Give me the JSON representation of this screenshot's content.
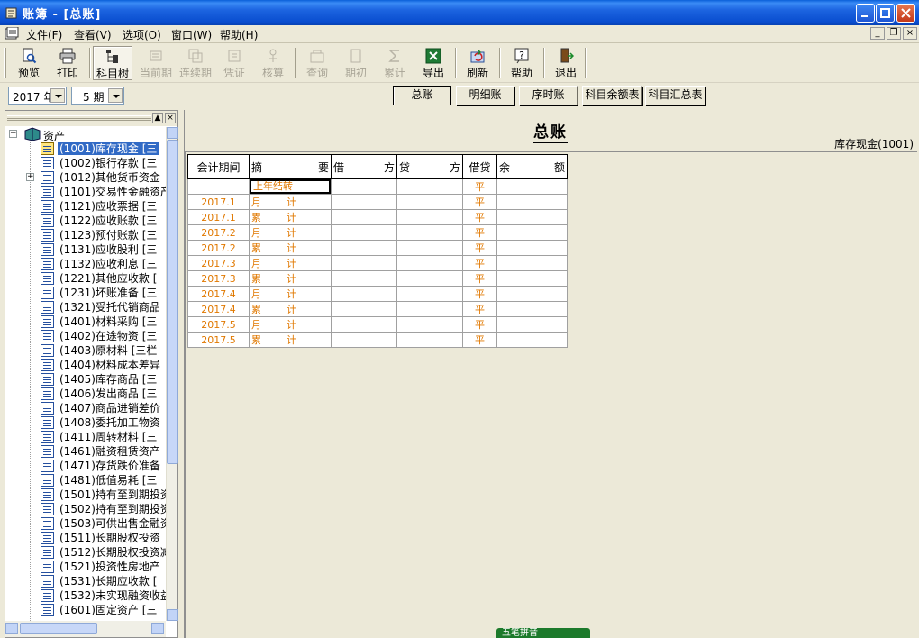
{
  "window": {
    "title": "账簿 - [总账]"
  },
  "menu": [
    "文件(F)",
    "查看(V)",
    "选项(O)",
    "窗口(W)",
    "帮助(H)"
  ],
  "toolbar": {
    "preview": "预览",
    "print": "打印",
    "subject_tree": "科目树",
    "prev_period": "当前期",
    "continuous": "连续期",
    "voucher": "凭证",
    "check": "核算",
    "query": "查询",
    "opening": "期初",
    "cumulative": "累计",
    "export": "导出",
    "refresh": "刷新",
    "help": "帮助",
    "exit": "退出"
  },
  "filters": {
    "year": "2017 年",
    "period": "5 期"
  },
  "report_tabs": {
    "general": "总账",
    "detail": "明细账",
    "chrono": "序时账",
    "balance": "科目余额表",
    "summary": "科目汇总表"
  },
  "tree": {
    "root": "资产",
    "items": [
      "(1001)库存现金 [三",
      "(1002)银行存款 [三",
      "(1012)其他货币资金",
      "(1101)交易性金融资产",
      "(1121)应收票据 [三",
      "(1122)应收账款 [三",
      "(1123)预付账款 [三",
      "(1131)应收股利 [三",
      "(1132)应收利息 [三",
      "(1221)其他应收款 [",
      "(1231)坏账准备 [三",
      "(1321)受托代销商品",
      "(1401)材料采购 [三",
      "(1402)在途物资 [三",
      "(1403)原材料 [三栏",
      "(1404)材料成本差异",
      "(1405)库存商品 [三",
      "(1406)发出商品 [三",
      "(1407)商品进销差价",
      "(1408)委托加工物资",
      "(1411)周转材料 [三",
      "(1461)融资租赁资产",
      "(1471)存货跌价准备",
      "(1481)低值易耗 [三",
      "(1501)持有至到期投资",
      "(1502)持有至到期投资",
      "(1503)可供出售金融资",
      "(1511)长期股权投资",
      "(1512)长期股权投资减",
      "(1521)投资性房地产",
      "(1531)长期应收款 [",
      "(1532)未实现融资收益",
      "(1601)固定资产 [三"
    ]
  },
  "doc": {
    "title": "总账",
    "account": "库存现金(1001)"
  },
  "ledger": {
    "headers": {
      "period": "会计期间",
      "summary_a": "摘",
      "summary_b": "要",
      "debit_a": "借",
      "debit_b": "方",
      "credit_a": "贷",
      "credit_b": "方",
      "dir": "借贷",
      "balance_a": "余",
      "balance_b": "额"
    },
    "first_row": {
      "summary": "上年结转",
      "dir": "平"
    },
    "rows": [
      {
        "period": "2017.1",
        "a": "月",
        "b": "计",
        "dir": "平"
      },
      {
        "period": "2017.1",
        "a": "累",
        "b": "计",
        "dir": "平"
      },
      {
        "period": "2017.2",
        "a": "月",
        "b": "计",
        "dir": "平"
      },
      {
        "period": "2017.2",
        "a": "累",
        "b": "计",
        "dir": "平"
      },
      {
        "period": "2017.3",
        "a": "月",
        "b": "计",
        "dir": "平"
      },
      {
        "period": "2017.3",
        "a": "累",
        "b": "计",
        "dir": "平"
      },
      {
        "period": "2017.4",
        "a": "月",
        "b": "计",
        "dir": "平"
      },
      {
        "period": "2017.4",
        "a": "累",
        "b": "计",
        "dir": "平"
      },
      {
        "period": "2017.5",
        "a": "月",
        "b": "计",
        "dir": "平"
      },
      {
        "period": "2017.5",
        "a": "累",
        "b": "计",
        "dir": "平"
      }
    ]
  },
  "ime": {
    "label": "五笔拼音"
  }
}
